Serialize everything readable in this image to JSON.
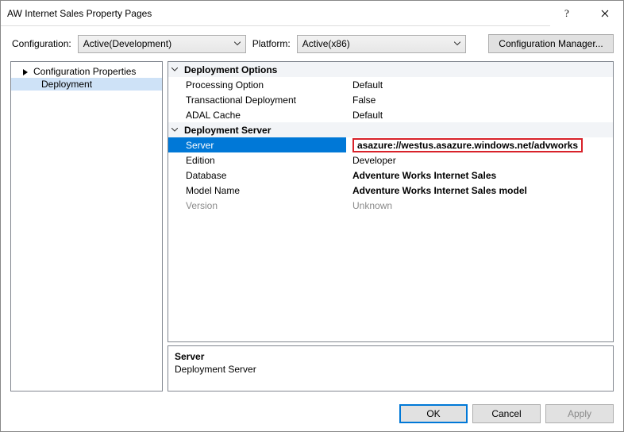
{
  "window": {
    "title": "AW Internet Sales Property Pages"
  },
  "configbar": {
    "config_label": "Configuration:",
    "config_value": "Active(Development)",
    "platform_label": "Platform:",
    "platform_value": "Active(x86)",
    "cfgmgr_label": "Configuration Manager..."
  },
  "tree": {
    "root": "Configuration Properties",
    "child": "Deployment"
  },
  "grid": {
    "cat1": "Deployment Options",
    "r1n": "Processing Option",
    "r1v": "Default",
    "r2n": "Transactional Deployment",
    "r2v": "False",
    "r3n": "ADAL Cache",
    "r3v": "Default",
    "cat2": "Deployment Server",
    "r4n": "Server",
    "r4v": "asazure://westus.asazure.windows.net/advworks",
    "r5n": "Edition",
    "r5v": "Developer",
    "r6n": "Database",
    "r6v": "Adventure Works Internet Sales",
    "r7n": "Model Name",
    "r7v": "Adventure Works Internet Sales model",
    "r8n": "Version",
    "r8v": "Unknown"
  },
  "desc": {
    "title": "Server",
    "body": "Deployment Server"
  },
  "buttons": {
    "ok": "OK",
    "cancel": "Cancel",
    "apply": "Apply"
  }
}
